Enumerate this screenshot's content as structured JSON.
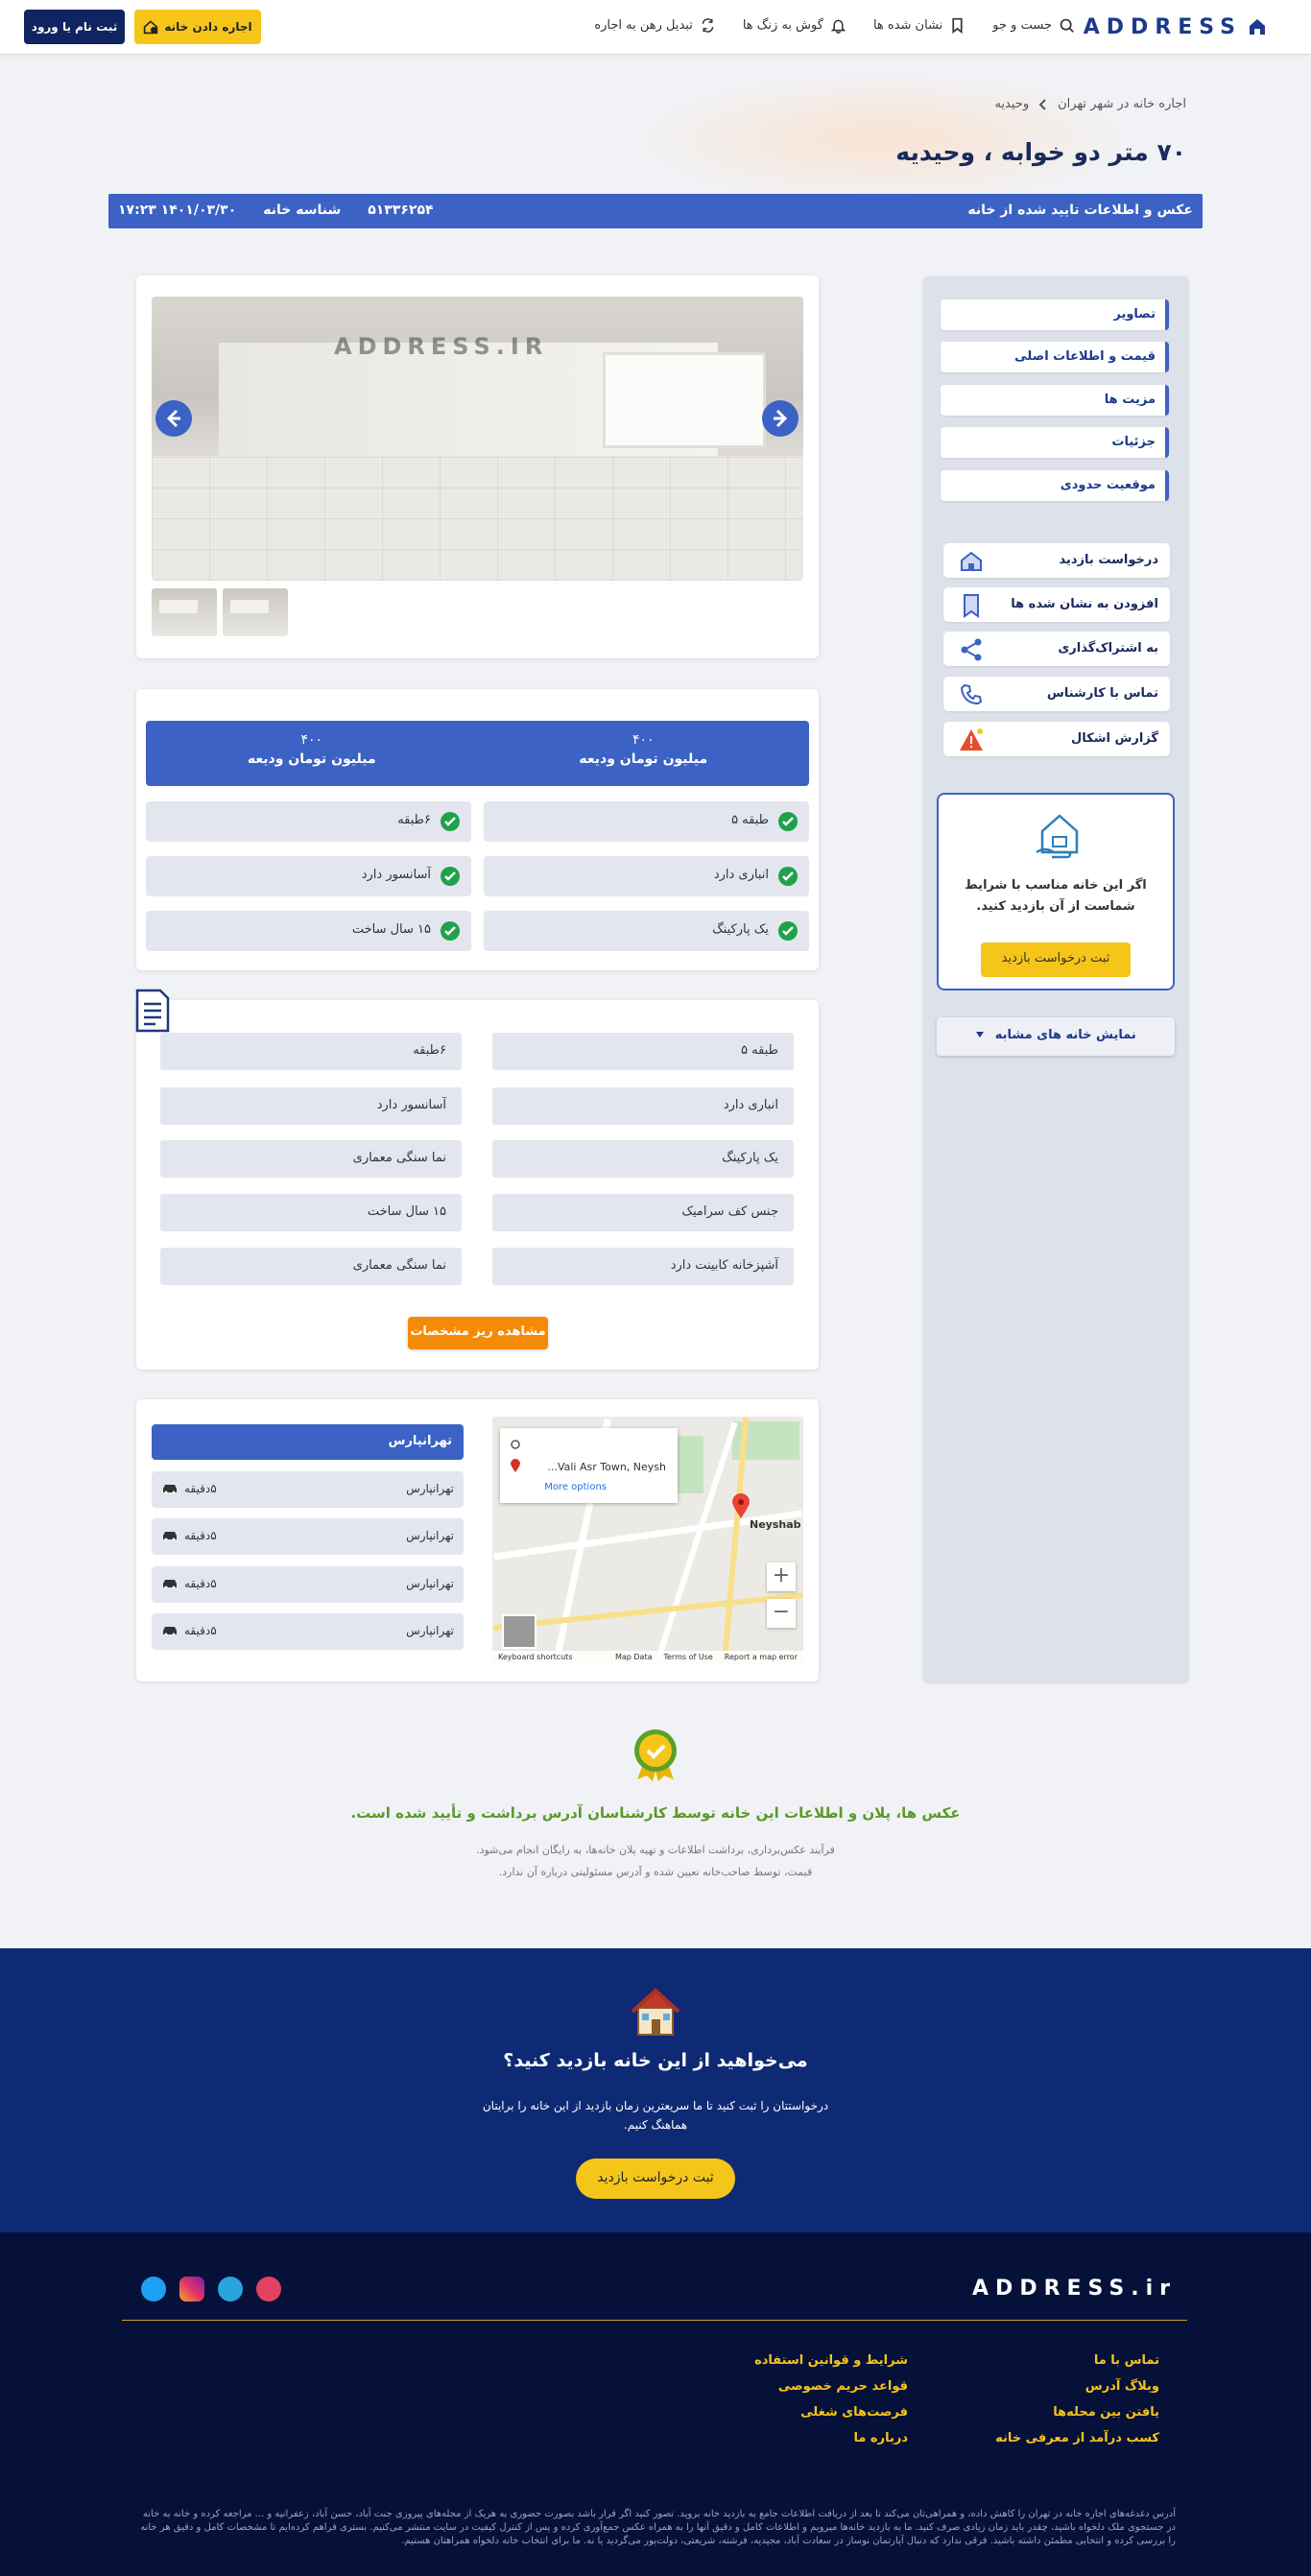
{
  "header": {
    "logo": "ADDRESS",
    "nav": [
      {
        "label": "جست و جو",
        "icon": "search-icon"
      },
      {
        "label": "نشان شده ها",
        "icon": "bookmark-icon"
      },
      {
        "label": "گوش به زنگ ها",
        "icon": "bell-icon"
      },
      {
        "label": "تبدیل رهن به اجاره",
        "icon": "convert-icon"
      }
    ],
    "rent_button": "اجاره دادن خانه",
    "login_button": "ثبت نام یا ورود"
  },
  "breadcrumb": [
    "اجاره خانه در شهر تهران",
    "وحیدیه"
  ],
  "title": "۷۰ متر دو خوابه ، وحیدیه",
  "info_bar": {
    "verified": "عکس و اطلاعات تایید شده از خانه",
    "datetime": "۱۴۰۱/۰۳/۳۰ ۱۷:۲۳",
    "id_label": "شناسه خانه",
    "id_value": "۵۱۳۳۶۲۵۴"
  },
  "sidebar": {
    "sections": [
      "تصاویر",
      "قیمت و اطلاعات اصلی",
      "مزیت ها",
      "جزئیات",
      "موقعیت حدودی"
    ],
    "actions": [
      {
        "label": "درخواست بازدید",
        "icon": "house-icon"
      },
      {
        "label": "افزودن به نشان شده ها",
        "icon": "bookmark-icon"
      },
      {
        "label": "به اشتراک‌گذاری",
        "icon": "share-icon"
      },
      {
        "label": "تماس با کارشناس",
        "icon": "phone-icon"
      },
      {
        "label": "گزارش اشکال",
        "icon": "warning-icon"
      }
    ],
    "visit_card_text": "اگر این خانه مناسب با شرایط شماست از آن بازدید کنید.",
    "visit_card_button": "ثبت درخواست بازدید",
    "similar_button": "نمایش خانه های مشابه"
  },
  "gallery": {
    "watermark": "ADDRESS.IR"
  },
  "price": {
    "right_value": "۴۰۰",
    "right_unit": "میلیون تومان ودیعه",
    "left_value": "۴۰۰",
    "left_unit": "میلیون تومان ودیعه"
  },
  "features": [
    "طبقه ۵",
    "۶طبقه",
    "انباری دارد",
    "آسانسور دارد",
    "یک پارکینگ",
    "۱۵ سال ساخت"
  ],
  "details": [
    "طبقه ۵",
    "۶طبقه",
    "انباری دارد",
    "آسانسور دارد",
    "یک پارکینگ",
    "نما سنگی معماری",
    "جنس کف سرامیک",
    "۱۵ سال ساخت",
    "آشپزخانه کابینت دارد",
    "نما سنگی معماری"
  ],
  "details_button": "مشاهده ریز مشخصات",
  "map": {
    "place": "Vali Asr Town, Neysh...",
    "more": "More options",
    "label": "Neyshab",
    "footer": [
      "Keyboard shortcuts",
      "Map Data",
      "Terms of Use",
      "Report a map error"
    ]
  },
  "neighborhoods": {
    "header": "تهرانپارس",
    "items": [
      {
        "name": "تهرانپارس",
        "time": "۵دقیقه"
      },
      {
        "name": "تهرانپارس",
        "time": "۵دقیقه"
      },
      {
        "name": "تهرانپارس",
        "time": "۵دقیقه"
      },
      {
        "name": "تهرانپارس",
        "time": "۵دقیقه"
      }
    ]
  },
  "verification": {
    "title": "عکس ها، پلان و اطلاعات این خانه توسط کارشناسان آدرس برداشت و تأیید شده است.",
    "line1": "فرآیند عکس‌برداری، برداشت اطلاعات و تهیه پلان خانه‌ها، به رایگان انجام می‌شود.",
    "line2": "قیمت، توسط صاحب‌خانه تعیین شده و آدرس مسئولیتی درباره آن ندارد."
  },
  "cta": {
    "title": "می‌خواهید از این خانه بازدید کنید؟",
    "subtitle": "درخواستتان را ثبت کنید تا ما سریعترین زمان بازدید از این خانه را برایتان هماهنگ کنیم.",
    "button": "ثبت درخواست بازدید"
  },
  "footer": {
    "logo": "ADDRESS.ir",
    "col1": [
      "تماس با ما",
      "وبلاگ آدرس",
      "یافتن بین محله‌ها",
      "کسب درآمد از معرفی خانه"
    ],
    "col2": [
      "شرایط و قوانین استفاده",
      "قواعد حریم خصوصی",
      "فرصت‌های شغلی",
      "درباره ما"
    ],
    "description": "آدرس دغدغه‌های اجاره خانه در تهران را کاهش داده، و همراهی‌تان می‌کند تا بعد از دریافت اطلاعات جامع به بازدید خانه بروید. تصور کنید اگر قرار باشد بصورت حضوری به هریک از محله‌های پیروزی جنت آباد، حسن آباد، زعفرانیه و ... مراجعه کرده و خانه به خانه در جستجوی ملک دلخواه باشید، چقدر باید زمان زیادی صرف کنید. ما به بازدید خانه‌ها میرویم و اطلاعات کامل و دقیق آنها را به همراه عکس جمع‌آوری کرده و پس از کنترل کیفیت در سایت منتشر می‌کنیم. بستری فراهم کرده‌ایم تا مشخصات کامل و دقیق هر خانه را بررسی کرده و انتخابی مطمئن داشته باشید. فرقی ندارد که دنبال آپارتمان نوساز در سعادت آباد، مجیدیه، فرشته، شریعتی، دولت‌پور می‌گردید یا نه. ما برای انتخاب خانه دلخواه همراهتان هستیم."
  },
  "colors": {
    "primary": "#3b62c4",
    "navy": "#0f2a74",
    "accent": "#f6c51a",
    "orange": "#f58a07",
    "green": "#1fa24a"
  }
}
